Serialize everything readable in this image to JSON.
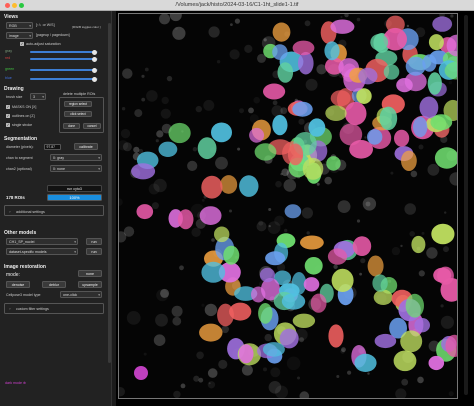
{
  "window": {
    "title": "/Volumes/jack/histo/2024-03-16/C1-1ht_slide1-1.tif"
  },
  "views": {
    "heading": "Views",
    "mode_value": "RGB",
    "image_value": "image",
    "mode_hint": "[↑/↓ or W/S]",
    "mode_hint2": "[R/G/B toggles color ]",
    "image_hint": "[pageup / pagedown]",
    "auto_adjust_label": "auto-adjust saturation",
    "channels": [
      {
        "label": "gray",
        "color": "#7a9a7a",
        "level": 0.95
      },
      {
        "label": "red",
        "color": "#d04040",
        "level": 0.95
      },
      {
        "label": "green",
        "color": "#40c040",
        "level": 0.95
      },
      {
        "label": "blue",
        "color": "#4070e0",
        "level": 0.95
      }
    ]
  },
  "drawing": {
    "heading": "Drawing",
    "brush_label": "brush size",
    "brush_value": "3",
    "masks_on_label": "MASKS ON [X]",
    "outlines_label": "outlines on [Z]",
    "single_stroke_label": "single stroke",
    "delete_rois_label": "delete multiple ROIs",
    "region_select_label": "region select",
    "click_select_label": "click select",
    "done_label": "done",
    "cancel_label": "cancel"
  },
  "segmentation": {
    "heading": "Segmentation",
    "diameter_label": "diameter (pixels):",
    "diameter_value": "97.87",
    "calibrate_label": "calibrate",
    "chan_segment_label": "chan to segment",
    "chan_segment_value": "0: gray",
    "chan2_label": "chan2 (optional)",
    "chan2_value": "0: none",
    "run_label": "run cyto3",
    "rois_label": "178 ROIs",
    "progress_text": "100%",
    "progress_fraction": 1.0,
    "additional_settings_label": "additional settings"
  },
  "other_models": {
    "heading": "Other models",
    "custom_value": "CH1_SP_nuclei",
    "dataset_value": "dataset-specific models",
    "run_label": "run",
    "run2_label": "run"
  },
  "restoration": {
    "heading": "Image restoration",
    "mode_label": "mode:",
    "buttons": [
      "none",
      "denoise",
      "deblur",
      "upsample"
    ],
    "model_type_label": "Cellpose3 model type",
    "model_type_value": "one-click",
    "custom_filter_label": "custom filter settings"
  },
  "footer": {
    "dark_mode_label": "dark mode ⊕"
  },
  "canvas": {
    "description_colors": [
      "#e85aa8",
      "#6aa0f0",
      "#f0a040",
      "#60d0a0",
      "#a070e0",
      "#f06060",
      "#50c0e0",
      "#c0e060",
      "#e070e0",
      "#70e070"
    ]
  }
}
